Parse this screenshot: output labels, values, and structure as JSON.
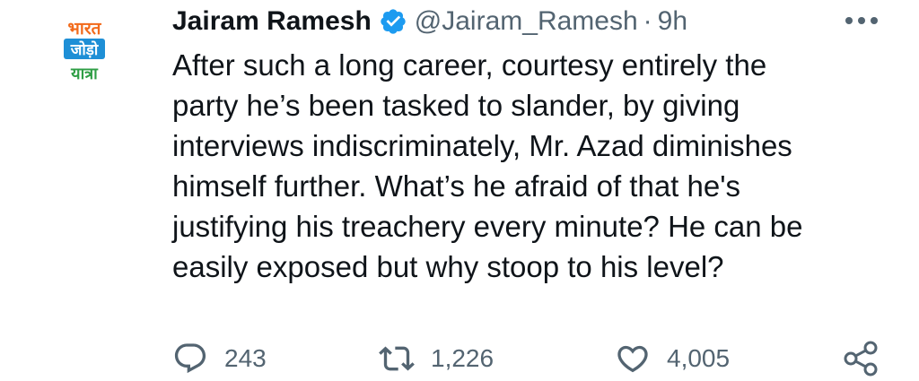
{
  "tweet": {
    "avatar": {
      "logo_lines": [
        "भारत",
        "जोड़ो",
        "यात्रा"
      ],
      "colors": [
        "#f26a1b",
        "#1e8fd6",
        "#2e9e45"
      ]
    },
    "author": {
      "name": "Jairam Ramesh",
      "handle": "@Jairam_Ramesh",
      "verified": true,
      "verified_color": "#1d9bf0"
    },
    "separator": "·",
    "time": "9h",
    "text": "After such a long career, courtesy entirely the\nparty he’s been tasked to slander, by giving\ninterviews indiscriminately, Mr. Azad diminishes\nhimself further. What’s he afraid of that he's\njustifying his treachery every minute? He can be\neasily exposed but why stoop to his level?",
    "actions": {
      "reply": {
        "icon": "reply-icon",
        "count": "243"
      },
      "retweet": {
        "icon": "retweet-icon",
        "count": "1,226"
      },
      "like": {
        "icon": "heart-icon",
        "count": "4,005"
      },
      "share": {
        "icon": "share-icon"
      }
    },
    "more_icon": "more-options-icon",
    "text_color": "#0f1419",
    "secondary_color": "#536471"
  }
}
